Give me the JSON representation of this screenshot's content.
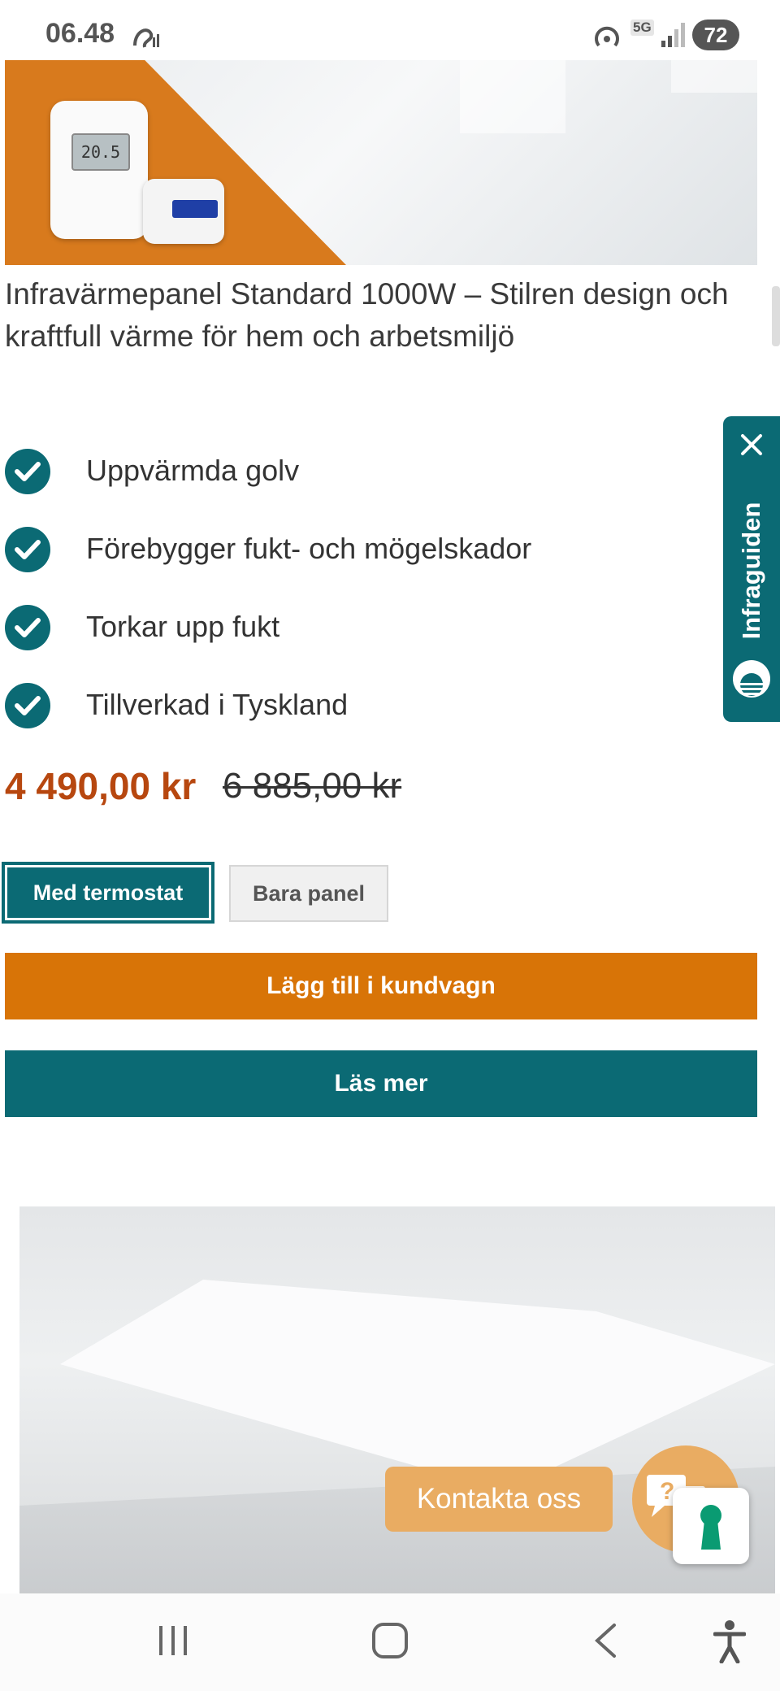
{
  "status_bar": {
    "time": "06.48",
    "network": "5G",
    "battery": "72"
  },
  "hero": {
    "thermostat_display": "20.5"
  },
  "product": {
    "title": "Infravärmepanel Standard 1000W – Stilren design och kraftfull värme för hem och arbetsmiljö"
  },
  "features": [
    "Uppvärmda golv",
    "Förebygger fukt- och mögelskador",
    "Torkar upp fukt",
    "Tillverkad i Tyskland"
  ],
  "price": {
    "current": "4 490,00 kr",
    "original": "6 885,00 kr"
  },
  "variants": {
    "selected": "Med termostat",
    "other": "Bara panel"
  },
  "actions": {
    "add_to_cart": "Lägg till i kundvagn",
    "read_more": "Läs mer"
  },
  "side_tab": {
    "label": "Infraguiden"
  },
  "contact": {
    "label": "Kontakta oss"
  },
  "colors": {
    "teal": "#0b6a74",
    "orange": "#d87407",
    "price": "#b7470f",
    "contact": "#e9ac62"
  },
  "icons": [
    "check-icon",
    "close-icon",
    "chat-icon",
    "keyhole-icon",
    "recents-icon",
    "home-icon",
    "back-icon",
    "accessibility-icon"
  ]
}
